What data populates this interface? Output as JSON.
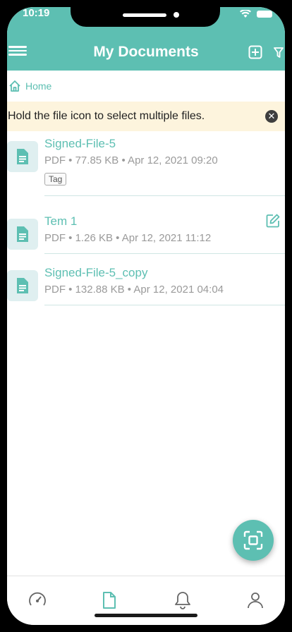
{
  "status_bar": {
    "time": "10:19"
  },
  "header": {
    "title": "My Documents",
    "menu_icon": "hamburger-icon",
    "add_icon": "add-square-icon",
    "filter_icon": "filter-icon"
  },
  "breadcrumb": {
    "home_label": "Home"
  },
  "hint": {
    "text": "Hold the file icon to select multiple files."
  },
  "files": [
    {
      "name": "Signed-File-5",
      "meta": "PDF • 77.85 KB • Apr 12, 2021 09:20",
      "tag": "Tag"
    },
    {
      "name": "Tem 1",
      "meta": "PDF • 1.26 KB • Apr 12, 2021 11:12"
    },
    {
      "name": "Signed-File-5_copy",
      "meta": "PDF • 132.88 KB • Apr 12, 2021 04:04"
    }
  ],
  "tabbar": [
    "dashboard-icon",
    "documents-icon",
    "notifications-icon",
    "profile-icon"
  ],
  "colors": {
    "accent": "#5dbfb2",
    "hint_bg": "#fdf4dd",
    "thumb_bg": "#dfeff0"
  }
}
